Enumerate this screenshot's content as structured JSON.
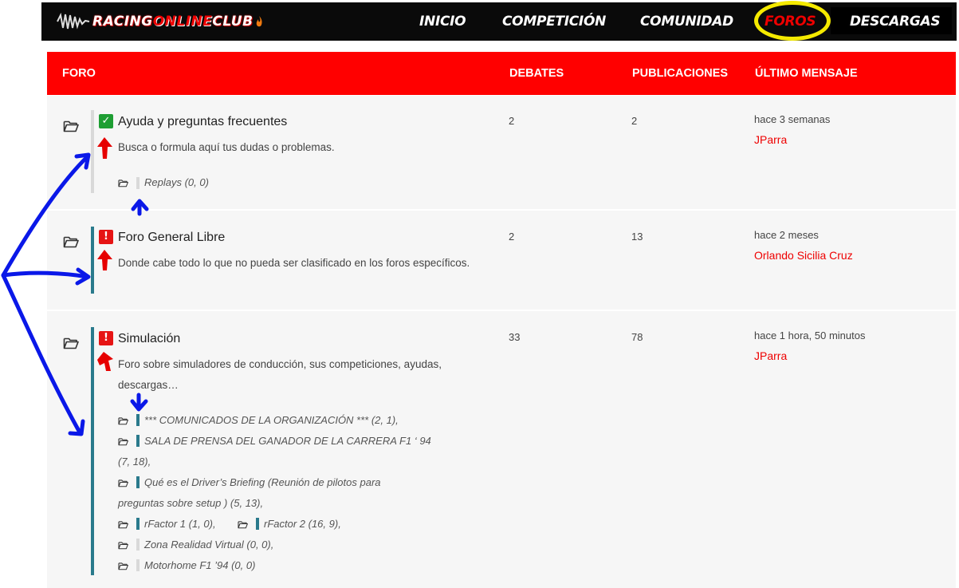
{
  "logo": {
    "prefix": "RACING",
    "middle": "ONLINE",
    "suffix": "CLUB"
  },
  "nav": {
    "inicio": "INICIO",
    "competicion": "COMPETICIÓN",
    "comunidad": "COMUNIDAD",
    "foros": "FOROS",
    "descargas": "DESCARGAS"
  },
  "colors": {
    "accent": "#ff0000",
    "highlight": "#f5ea00",
    "ok": "#1e9e33",
    "teal": "#2a7a8c",
    "annotation_blue": "#0a18e8"
  },
  "table": {
    "headers": {
      "foro": "FORO",
      "debates": "DEBATES",
      "publicaciones": "PUBLICACIONES",
      "ultimo": "ÚLTIMO MENSAJE"
    },
    "forums": [
      {
        "title": "Ayuda y preguntas frecuentes",
        "status_icon": "check-icon",
        "description": "Busca o formula aquí tus dudas o problemas.",
        "debates": "2",
        "publicaciones": "2",
        "last_time": "hace 3 semanas",
        "last_user": "JParra",
        "subforums": [
          "Replays (0, 0)"
        ]
      },
      {
        "title": "Foro General Libre",
        "status_icon": "alert-icon",
        "description": "Donde cabe todo lo que no pueda ser clasificado en los foros específicos.",
        "debates": "2",
        "publicaciones": "13",
        "last_time": "hace 2 meses",
        "last_user": "Orlando Sicilia Cruz",
        "subforums": []
      },
      {
        "title": "Simulación",
        "status_icon": "alert-icon",
        "description": "Foro sobre simuladores de conducción, sus competiciones, ayudas, descargas…",
        "debates": "33",
        "publicaciones": "78",
        "last_time": "hace 1 hora, 50 minutos",
        "last_user": "JParra",
        "subforums": [
          "*** COMUNICADOS DE LA ORGANIZACIÓN *** (2, 1),",
          "SALA DE PRENSA DEL GANADOR DE LA CARRERA F1 ‘ 94",
          "(7, 18),",
          "Qué es el Driver’s Briefing (Reunión de pilotos para",
          "preguntas sobre setup ) (5, 13),",
          "rFactor 1 (1, 0),",
          "rFactor 2 (16, 9),",
          "Zona Realidad Virtual (0, 0),",
          "Motorhome F1 ’94 (0, 0)"
        ]
      }
    ]
  }
}
